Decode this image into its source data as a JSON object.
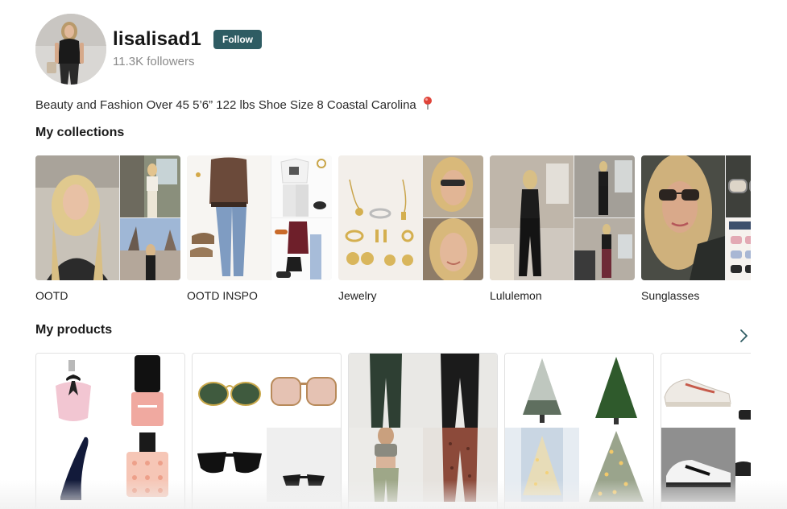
{
  "profile": {
    "username": "lisalisad1",
    "follow_label": "Follow",
    "followers": "11.3K followers",
    "bio": "Beauty and Fashion Over 45 5’6” 122 lbs Shoe Size 8 Coastal Carolina",
    "bio_emoji_icon": "round-pushpin-icon"
  },
  "collections": {
    "title": "My collections",
    "items": [
      {
        "label": "OOTD"
      },
      {
        "label": "OOTD INSPO"
      },
      {
        "label": "Jewelry"
      },
      {
        "label": "Lululemon"
      },
      {
        "label": "Sunglasses"
      }
    ]
  },
  "products": {
    "title": "My products",
    "next_icon": "chevron-right-icon",
    "items": [
      {
        "name": "perfume"
      },
      {
        "name": "sunglasses"
      },
      {
        "name": "leggings"
      },
      {
        "name": "christmas-trees"
      },
      {
        "name": "sneakers"
      }
    ]
  },
  "colors": {
    "follow_button": "#2f5c63",
    "followers_text": "#8a8a8a",
    "card_border": "#e1e1e1"
  }
}
